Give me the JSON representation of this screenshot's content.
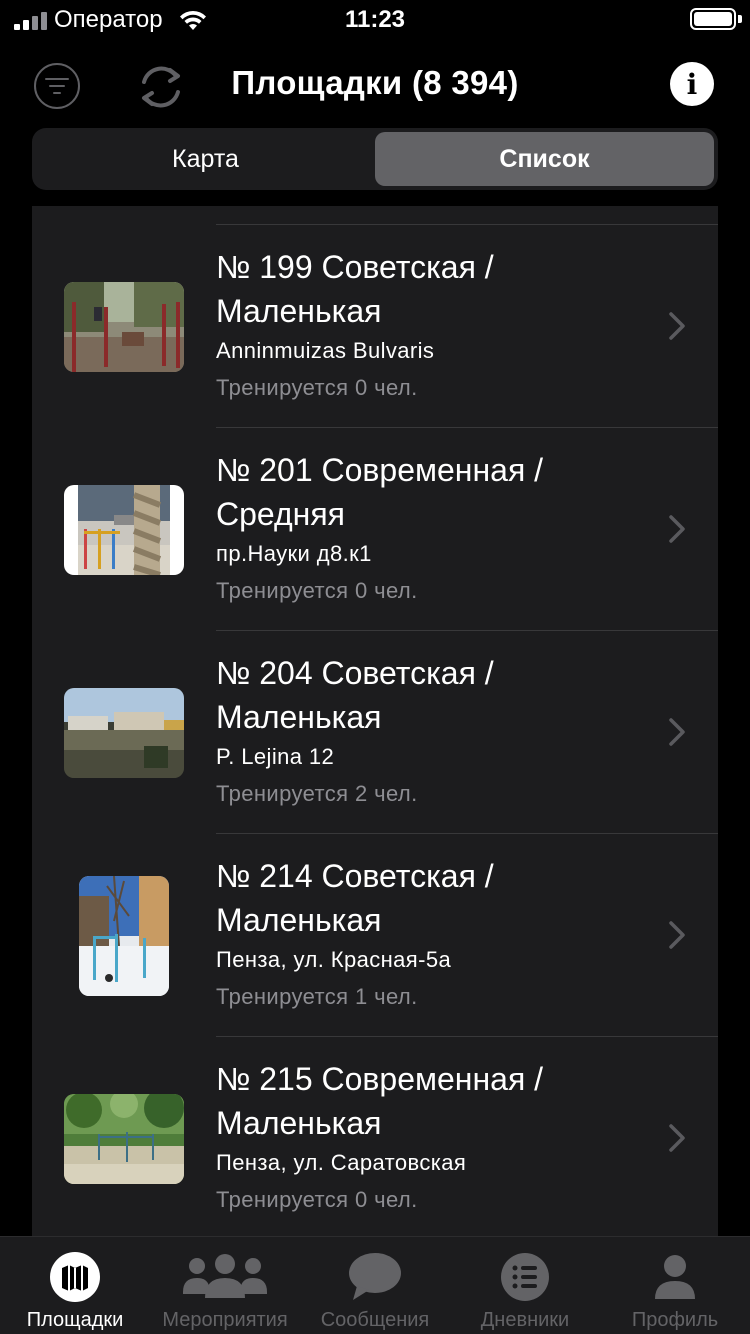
{
  "status_bar": {
    "carrier": "Оператор",
    "time": "11:23"
  },
  "header": {
    "title": "Площадки (8 394)",
    "filter_icon": "filter-icon",
    "refresh_icon": "refresh-icon",
    "info_icon": "info-icon",
    "info_glyph": "i"
  },
  "segmented": {
    "options": [
      "Карта",
      "Список"
    ],
    "selected": "Список"
  },
  "list": {
    "items": [
      {
        "title": "№ 199 Советская / Маленькая",
        "address": "Anninmuizas Bulvaris",
        "training": "Тренируется 0 чел.",
        "photo": "playground-swings-photo"
      },
      {
        "title": "№ 201 Современная / Средняя",
        "address": "пр.Науки д8.к1",
        "training": "Тренируется 0 чел.",
        "photo": "rope-bars-photo"
      },
      {
        "title": "№ 204 Советская / Маленькая",
        "address": "P. Lejina 12",
        "training": "Тренируется 2 чел.",
        "photo": "field-buildings-photo"
      },
      {
        "title": "№ 214 Советская / Маленькая",
        "address": "Пенза, ул. Красная-5а",
        "training": "Тренируется 1 чел.",
        "photo": "snowy-bars-photo"
      },
      {
        "title": "№ 215 Современная / Маленькая",
        "address": "Пенза, ул. Саратовская",
        "training": "Тренируется 0 чел.",
        "photo": "green-park-photo"
      }
    ]
  },
  "tab_bar": {
    "tabs": [
      {
        "label": "Площадки",
        "icon": "map-icon",
        "active": true
      },
      {
        "label": "Мероприятия",
        "icon": "people-icon",
        "active": false
      },
      {
        "label": "Сообщения",
        "icon": "chat-bubble-icon",
        "active": false
      },
      {
        "label": "Дневники",
        "icon": "list-icon",
        "active": false
      },
      {
        "label": "Профиль",
        "icon": "person-icon",
        "active": false
      }
    ]
  },
  "colors": {
    "background": "#000000",
    "list_background": "#1c1c1e",
    "segment_active": "#636366",
    "secondary_text": "#8e8e93",
    "inactive_tab": "#636366"
  }
}
